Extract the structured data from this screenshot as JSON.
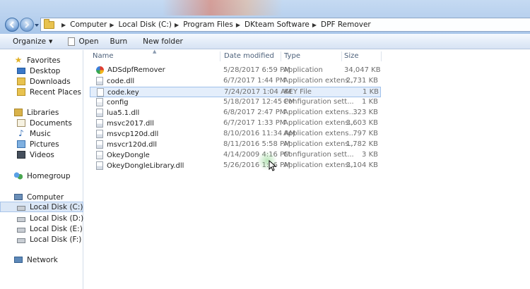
{
  "address": {
    "crumbs": [
      "Computer",
      "Local Disk (C:)",
      "Program Files",
      "DKteam Software",
      "DPF Remover"
    ]
  },
  "toolbar": {
    "organize": "Organize",
    "open": "Open",
    "burn": "Burn",
    "new_folder": "New folder"
  },
  "navpane": {
    "favorites": "Favorites",
    "desktop": "Desktop",
    "downloads": "Downloads",
    "recent": "Recent Places",
    "libraries": "Libraries",
    "documents": "Documents",
    "music": "Music",
    "pictures": "Pictures",
    "videos": "Videos",
    "homegroup": "Homegroup",
    "computer": "Computer",
    "disk_c": "Local Disk (C:)",
    "disk_d": "Local Disk (D:)",
    "disk_e": "Local Disk (E:)",
    "disk_f": "Local Disk (F:)",
    "network": "Network"
  },
  "columns": {
    "name": "Name",
    "date": "Date modified",
    "type": "Type",
    "size": "Size"
  },
  "files": [
    {
      "name": "ADSdpfRemover",
      "date": "5/28/2017 6:59 PM",
      "type": "Application",
      "size": "34,047 KB",
      "icon": "app-icon"
    },
    {
      "name": "code.dll",
      "date": "6/7/2017 1:44 PM",
      "type": "Application extens...",
      "size": "2,731 KB",
      "icon": "dll-icon"
    },
    {
      "name": "code.key",
      "date": "7/24/2017 1:04 AM",
      "type": "KEY File",
      "size": "1 KB",
      "icon": "file-icon"
    },
    {
      "name": "config",
      "date": "5/18/2017 12:45 PM",
      "type": "Configuration sett...",
      "size": "1 KB",
      "icon": "config-icon"
    },
    {
      "name": "lua5.1.dll",
      "date": "6/8/2017 2:47 PM",
      "type": "Application extens...",
      "size": "323 KB",
      "icon": "dll-icon"
    },
    {
      "name": "msvc2017.dll",
      "date": "6/7/2017 1:33 PM",
      "type": "Application extens...",
      "size": "3,603 KB",
      "icon": "dll-icon"
    },
    {
      "name": "msvcp120d.dll",
      "date": "8/10/2016 11:34 AM",
      "type": "Application extens...",
      "size": "797 KB",
      "icon": "dll-icon"
    },
    {
      "name": "msvcr120d.dll",
      "date": "8/11/2016 5:58 PM",
      "type": "Application extens...",
      "size": "1,782 KB",
      "icon": "dll-icon"
    },
    {
      "name": "OkeyDongle",
      "date": "4/14/2009 4:16 PM",
      "type": "Configuration sett...",
      "size": "3 KB",
      "icon": "config-icon"
    },
    {
      "name": "OkeyDongleLibrary.dll",
      "date": "5/26/2016 1:46 PM",
      "type": "Application extens...",
      "size": "3,104 KB",
      "icon": "dll-icon"
    }
  ],
  "selected_file": "code.key"
}
